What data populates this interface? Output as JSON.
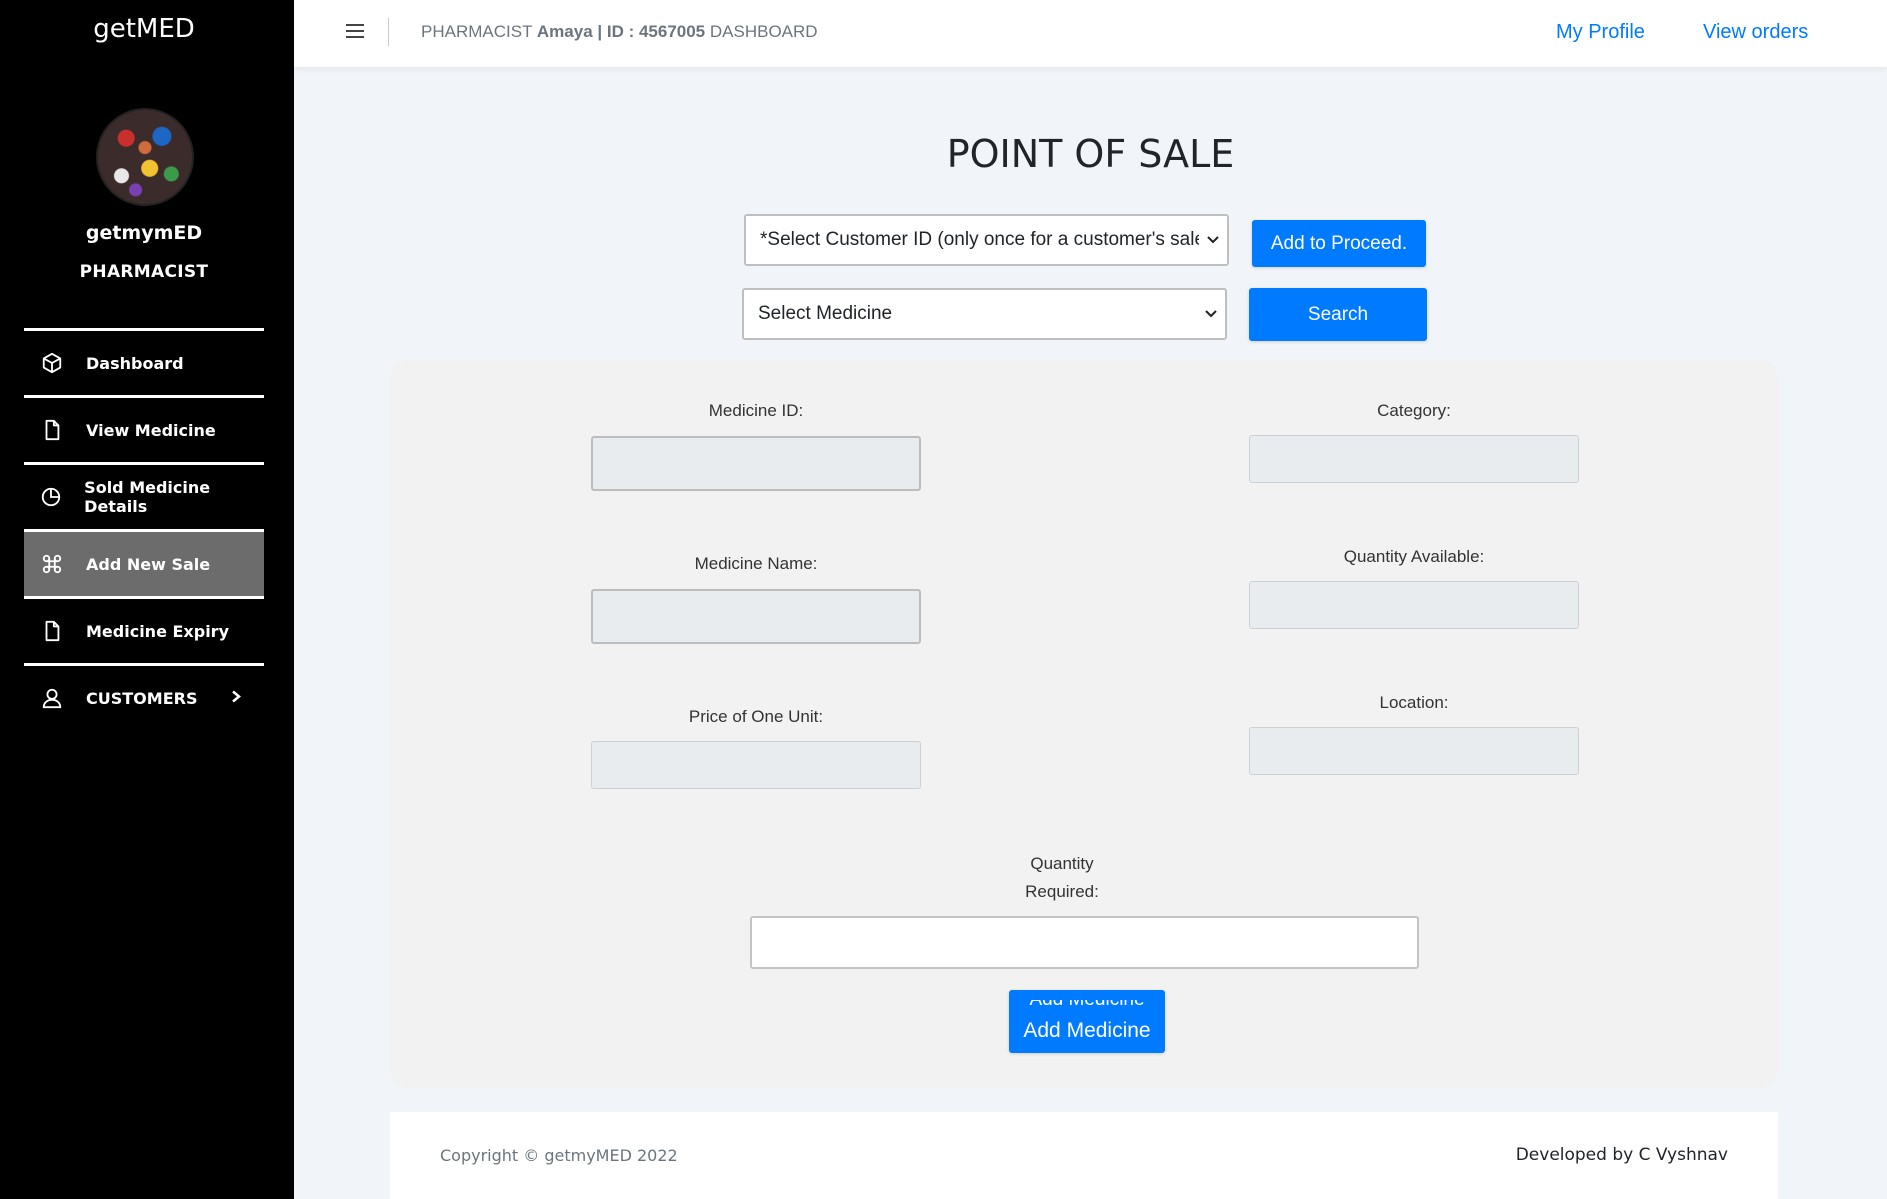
{
  "sidebar": {
    "brand": "getMED",
    "user_name": "getmymED",
    "user_role": "PHARMACIST",
    "items": [
      {
        "label": "Dashboard",
        "icon": "cube-icon"
      },
      {
        "label": "View Medicine",
        "icon": "file-icon"
      },
      {
        "label": "Sold Medicine Details",
        "icon": "pie-chart-icon"
      },
      {
        "label": "Add New Sale",
        "icon": "command-icon",
        "active": true
      },
      {
        "label": "Medicine Expiry",
        "icon": "file-icon"
      },
      {
        "label": "CUSTOMERS",
        "icon": "user-icon",
        "has_submenu": true
      }
    ]
  },
  "topbar": {
    "role_prefix": "PHARMACIST",
    "user_and_id": "Amaya | ID : 4567005",
    "suffix": "DASHBOARD",
    "links": {
      "profile": "My Profile",
      "orders": "View orders"
    }
  },
  "main": {
    "title": "POINT OF SALE",
    "customer_select": "*Select Customer ID (only once for a customer's sales)",
    "proceed_button": "Add to Proceed.",
    "medicine_select": "Select Medicine",
    "search_button": "Search",
    "fields": {
      "medicine_id": "Medicine ID:",
      "medicine_name": "Medicine Name:",
      "price": "Price of One Unit:",
      "category": "Category:",
      "qty_available": "Quantity Available:",
      "location": "Location:",
      "qty_required": "Quantity Required:"
    },
    "add_button": "Add Medicine"
  },
  "footer": {
    "copyright": "Copyright © getmyMED 2022",
    "developer": "Developed by C Vyshnav"
  },
  "colors": {
    "accent": "#007bff",
    "sidebar_bg": "#000000",
    "active_item_bg": "#6c6c6c",
    "page_bg": "#f1f4f8"
  }
}
